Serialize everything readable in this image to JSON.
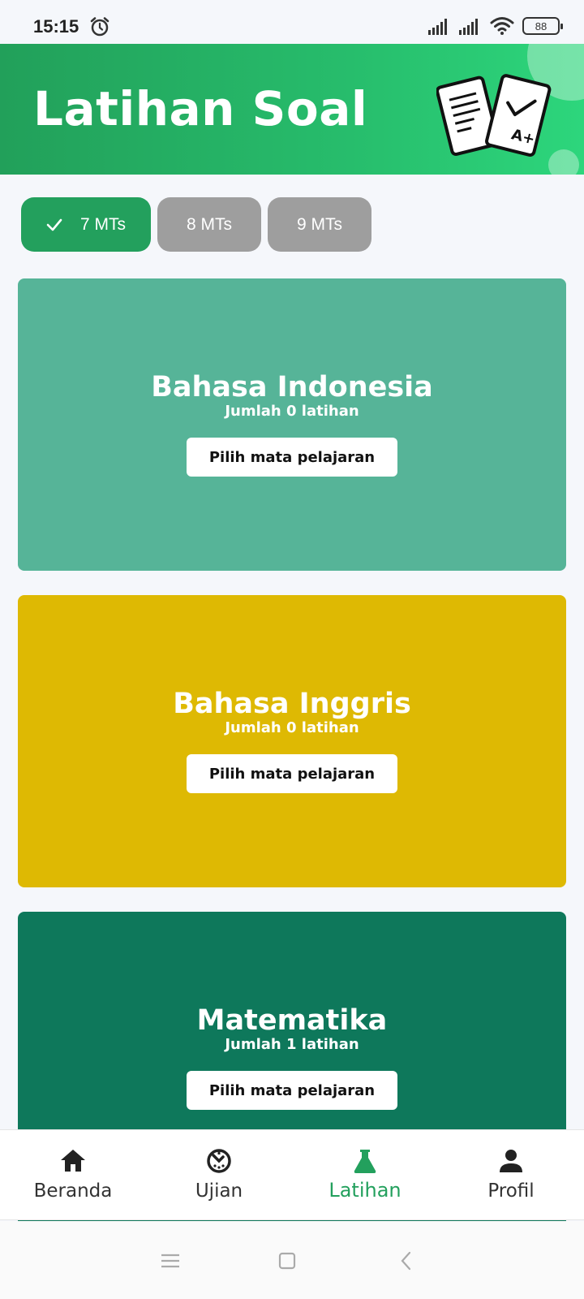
{
  "status_bar": {
    "time": "15:15",
    "battery": "88"
  },
  "header": {
    "title": "Latihan Soal"
  },
  "grade_filters": [
    {
      "label": "7 MTs",
      "selected": true
    },
    {
      "label": "8 MTs",
      "selected": false
    },
    {
      "label": "9 MTs",
      "selected": false
    }
  ],
  "subjects": [
    {
      "name": "Bahasa Indonesia",
      "count_text": "Jumlah 0 latihan",
      "button_label": "Pilih mata pelajaran",
      "color": "#56b498"
    },
    {
      "name": "Bahasa Inggris",
      "count_text": "Jumlah 0 latihan",
      "button_label": "Pilih mata pelajaran",
      "color": "#deb903"
    },
    {
      "name": "Matematika",
      "count_text": "Jumlah 1 latihan",
      "button_label": "Pilih mata pelajaran",
      "color": "#0e785b"
    }
  ],
  "bottom_nav": [
    {
      "label": "Beranda",
      "icon": "home-icon",
      "active": false
    },
    {
      "label": "Ujian",
      "icon": "timer-icon",
      "active": false
    },
    {
      "label": "Latihan",
      "icon": "flask-icon",
      "active": true
    },
    {
      "label": "Profil",
      "icon": "person-icon",
      "active": false
    }
  ],
  "colors": {
    "accent": "#23a05d",
    "chip_inactive": "#9e9e9e"
  }
}
